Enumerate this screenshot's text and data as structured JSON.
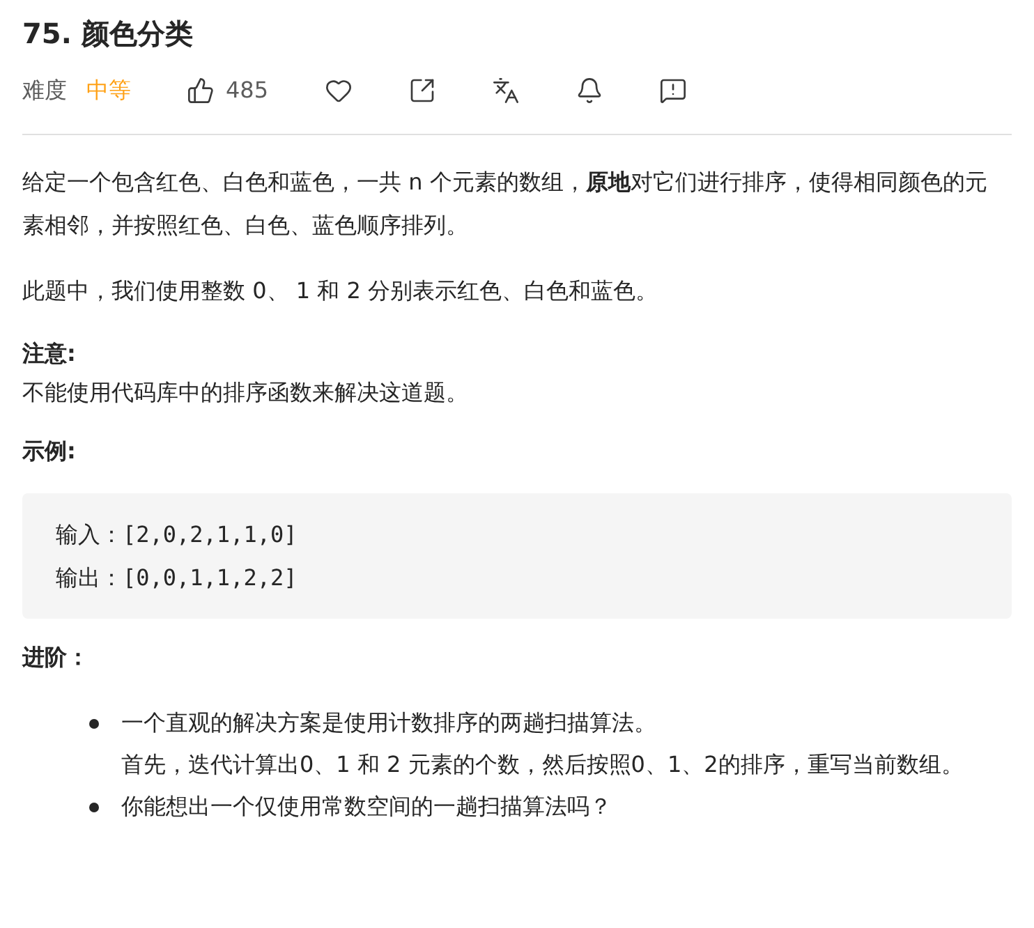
{
  "title": "75. 颜色分类",
  "meta": {
    "difficulty_label": "难度",
    "difficulty": "中等",
    "likes": "485"
  },
  "description": [
    "给定一个包含红色、白色和蓝色，一共 n 个元素的数组，**原地**对它们进行排序，使得相同颜色的元素相邻，并按照红色、白色、蓝色顺序排列。",
    "此题中，我们使用整数 0、 1 和 2 分别表示红色、白色和蓝色。"
  ],
  "note": {
    "heading": "注意:",
    "text": "不能使用代码库中的排序函数来解决这道题。"
  },
  "example": {
    "heading": "示例:",
    "lines": [
      {
        "label": "输入：",
        "value": "[2,0,2,1,1,0]"
      },
      {
        "label": "输出：",
        "value": "[0,0,1,1,2,2]"
      }
    ]
  },
  "follow_up": {
    "heading": "进阶：",
    "items": [
      {
        "lines": [
          "一个直观的解决方案是使用计数排序的两趟扫描算法。",
          "首先，迭代计算出0、1 和 2 元素的个数，然后按照0、1、2的排序，重写当前数组。"
        ]
      },
      {
        "lines": [
          "你能想出一个仅使用常数空间的一趟扫描算法吗？"
        ]
      }
    ]
  }
}
